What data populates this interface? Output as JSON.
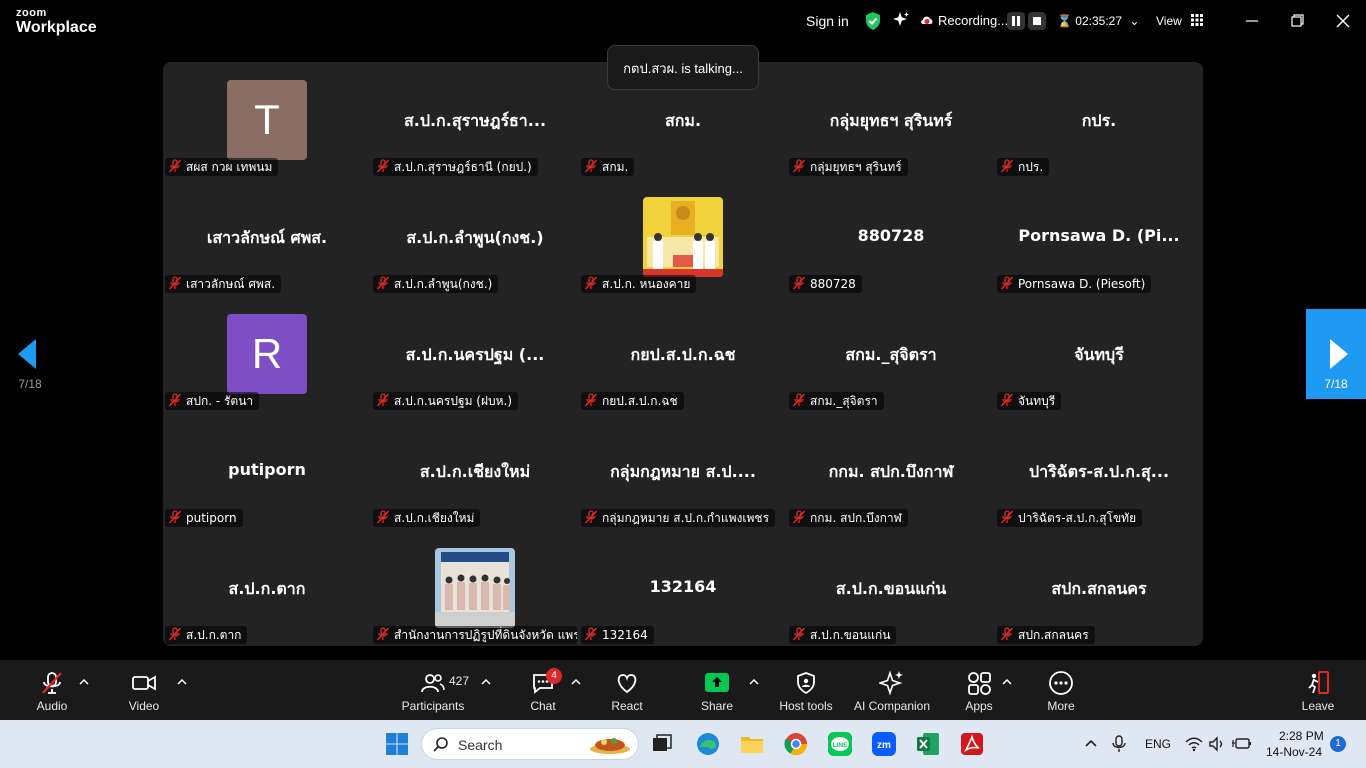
{
  "titlebar": {
    "brand_small": "zoom",
    "brand_large": "Workplace",
    "sign_in": "Sign in",
    "recording": "Recording...",
    "timer": "02:35:27",
    "view": "View"
  },
  "talking_indicator": "กตป.สวผ. is talking...",
  "gallery": {
    "page_left": "7/18",
    "page_right": "7/18",
    "tiles": [
      {
        "big": "",
        "avatar_letter": "T",
        "avatar_color": "#8a6e64",
        "label": "สผส กวผ เทพนม"
      },
      {
        "big": "ส.ป.ก.สุราษฎร์ธา...",
        "label": "ส.ป.ก.สุราษฎร์ธานี (กยป.)"
      },
      {
        "big": "สกม.",
        "label": "สกม."
      },
      {
        "big": "กลุ่มยุทธฯ สุรินทร์",
        "label": "กลุ่มยุทธฯ สุรินทร์"
      },
      {
        "big": "กปร.",
        "label": "กปร."
      },
      {
        "big": "เสาวลักษณ์ ศพส.",
        "label": "เสาวลักษณ์ ศพส."
      },
      {
        "big": "ส.ป.ก.ลำพูน(กงช.)",
        "label": "ส.ป.ก.ลำพูน(กงช.)"
      },
      {
        "big": "",
        "photo": "yellow-ceremony",
        "label": "ส.ป.ก. หนองคาย"
      },
      {
        "big": "880728",
        "label": "880728"
      },
      {
        "big": "Pornsawa D. (Pi...",
        "label": "Pornsawa D. (Piesoft)"
      },
      {
        "big": "",
        "avatar_letter": "R",
        "avatar_color": "#7e4fc4",
        "label": "สปก. - รัตนา"
      },
      {
        "big": "ส.ป.ก.นครปฐม (...",
        "label": "ส.ป.ก.นครปฐม (ฝบห.)"
      },
      {
        "big": "กยป.ส.ป.ก.ฉช",
        "label": "กยป.ส.ป.ก.ฉช"
      },
      {
        "big": "สกม._สุจิตรา",
        "label": "สกม._สุจิตรา"
      },
      {
        "big": "จันทบุรี",
        "label": "จันทบุรี"
      },
      {
        "big": "putiporn",
        "label": "putiporn"
      },
      {
        "big": "ส.ป.ก.เชียงใหม่",
        "label": "ส.ป.ก.เชียงใหม่"
      },
      {
        "big": "กลุ่มกฎหมาย ส.ป....",
        "label": "กลุ่มกฎหมาย ส.ป.ก.กำแพงเพชร"
      },
      {
        "big": "กกม. สปก.บึงกาฬ",
        "label": "กกม. สปก.บึงกาฬ"
      },
      {
        "big": "ปาริฉัตร-ส.ป.ก.สุ...",
        "label": "ปาริฉัตร-ส.ป.ก.สุโขทัย"
      },
      {
        "big": "ส.ป.ก.ตาก",
        "label": "ส.ป.ก.ตาก"
      },
      {
        "big": "",
        "photo": "group-photo",
        "label": "สำนักงานการปฏิรูปที่ดินจังหวัด แพร่"
      },
      {
        "big": "132164",
        "label": "132164"
      },
      {
        "big": "ส.ป.ก.ขอนแก่น",
        "label": "ส.ป.ก.ขอนแก่น"
      },
      {
        "big": "สปก.สกลนคร",
        "label": "สปก.สกลนคร"
      }
    ]
  },
  "toolbar": {
    "audio": "Audio",
    "video": "Video",
    "participants": "Participants",
    "participants_count": "427",
    "chat": "Chat",
    "chat_badge": "4",
    "react": "React",
    "share": "Share",
    "host_tools": "Host tools",
    "ai_companion": "AI Companion",
    "apps": "Apps",
    "more": "More",
    "leave": "Leave"
  },
  "taskbar": {
    "search_placeholder": "Search",
    "lang": "ENG",
    "time": "2:28 PM",
    "date": "14-Nov-24",
    "notif_count": "1"
  },
  "colors": {
    "share_green": "#00c853",
    "page_blue": "#1e9af2",
    "mic_red": "#e02828"
  }
}
